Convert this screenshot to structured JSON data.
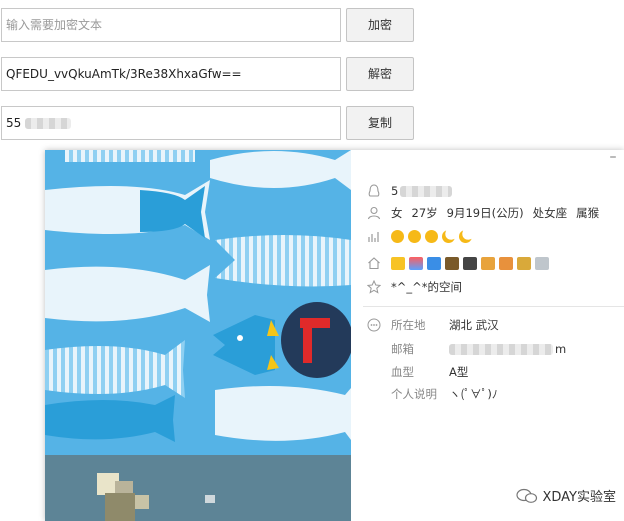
{
  "tool": {
    "input_placeholder": "输入需要加密文本",
    "encrypt_label": "加密",
    "cipher_value": "QFEDU_vvQkuAmTk/3Re38XhxaGfw==",
    "decrypt_label": "解密",
    "plain_value_visible": "55",
    "copy_label": "复制"
  },
  "profile": {
    "qq_visible": "5",
    "gender": "女",
    "age": "27岁",
    "birthday": "9月19日(公历)",
    "zodiac": "处女座",
    "animal": "属猴",
    "space_name": "*^_^*的空间",
    "location_label": "所在地",
    "location_value": "湖北 武汉",
    "email_label": "邮箱",
    "email_visible_suffix": "m",
    "blood_label": "血型",
    "blood_value": "A型",
    "bio_label": "个人说明",
    "bio_value": "ヽ(ﾟ∀ﾟ)ﾉ",
    "minimize_glyph": "–",
    "level_icons": [
      "sun-icon",
      "sun-icon",
      "sun-icon",
      "moon-icon",
      "moon-icon"
    ],
    "service_icons": [
      "star-icon",
      "video-icon",
      "photo-icon",
      "game-icon",
      "pet-icon",
      "character-icon",
      "music-icon",
      "gift-icon",
      "diamond-icon"
    ]
  },
  "watermark": {
    "text": "XDAY实验室"
  },
  "colors": {
    "art_background": "#55b3e6",
    "fish_white": "#e8f4fb",
    "fish_blue": "#2a9ed8",
    "penguin_body": "#233a5a",
    "scarf_red": "#e02a2a"
  }
}
